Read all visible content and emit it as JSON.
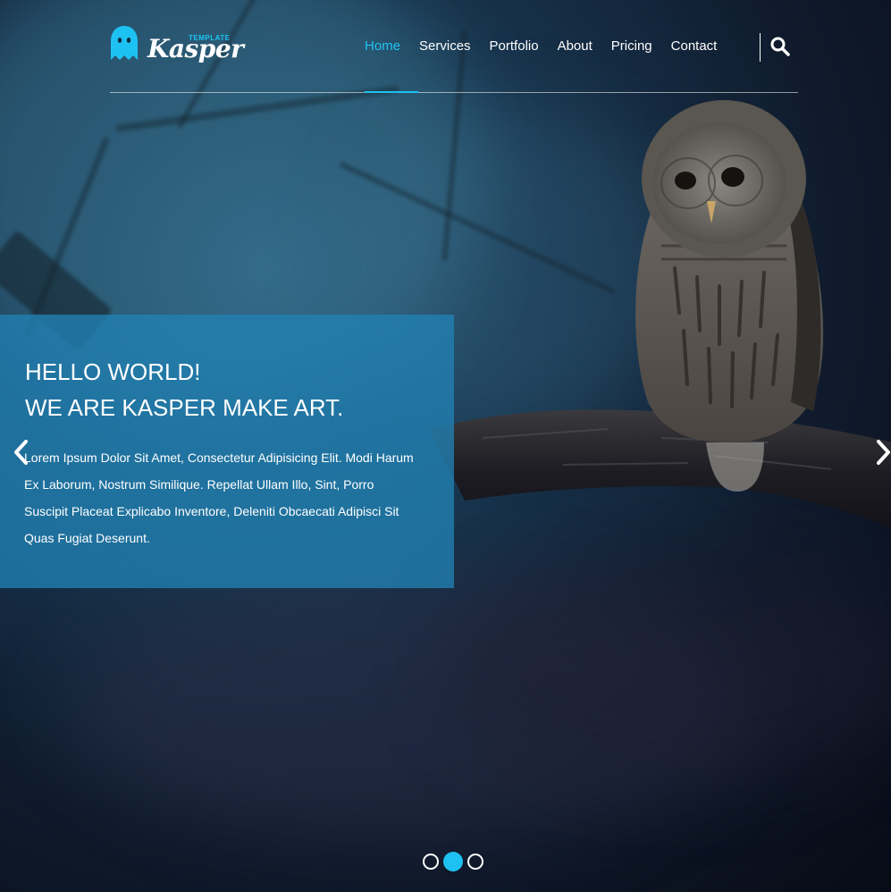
{
  "brand": {
    "name": "Kasper",
    "tag": "TEMPLATE",
    "accent_color": "#1ec2f2",
    "logo_icon": "ghost-icon"
  },
  "nav": {
    "items": [
      {
        "label": "Home",
        "active": true
      },
      {
        "label": "Services",
        "active": false
      },
      {
        "label": "Portfolio",
        "active": false
      },
      {
        "label": "About",
        "active": false
      },
      {
        "label": "Pricing",
        "active": false
      },
      {
        "label": "Contact",
        "active": false
      }
    ],
    "search_icon": "search-icon"
  },
  "slider": {
    "title_line1": "HELLO WORLD!",
    "title_line2": "WE ARE KASPER MAKE ART.",
    "text": "Lorem Ipsum Dolor Sit Amet, Consectetur Adipisicing Elit. Modi Harum Ex Laborum, Nostrum Similique. Repellat Ullam Illo, Sint, Porro Suscipit Placeat Explicabo Inventore, Deleniti Obcaecati Adipisci Sit Quas Fugiat Deserunt.",
    "prev_icon": "chevron-left-icon",
    "next_icon": "chevron-right-icon",
    "bullets": 3,
    "active_bullet": 2,
    "caption_color": "#2182b4"
  }
}
